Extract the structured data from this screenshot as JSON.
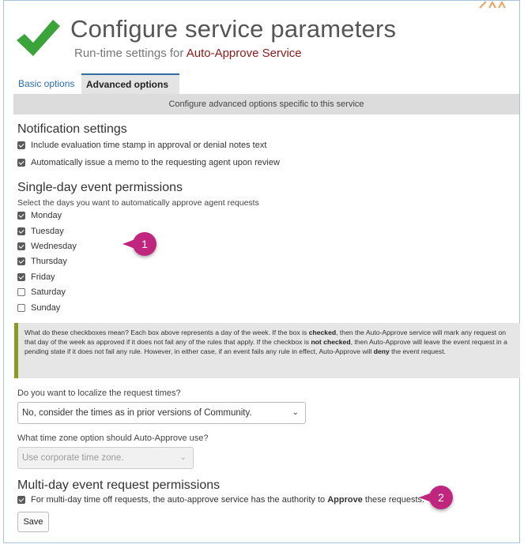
{
  "header": {
    "title": "Configure service parameters",
    "subtitle_prefix": "Run-time settings for",
    "service_name": "Auto-Approve Service"
  },
  "tabs": [
    {
      "label": "Basic options",
      "active": false
    },
    {
      "label": "Advanced options",
      "active": true
    }
  ],
  "banner": "Configure advanced options specific to this service",
  "notification": {
    "heading": "Notification settings",
    "options": [
      {
        "label": "Include evaluation time stamp in approval or denial notes text",
        "checked": true
      },
      {
        "label": "Automatically issue a memo to the requesting agent upon review",
        "checked": true
      }
    ]
  },
  "single_day": {
    "heading": "Single-day event permissions",
    "description": "Select the days you want to automatically approve agent requests",
    "days": [
      {
        "label": "Monday",
        "checked": true
      },
      {
        "label": "Tuesday",
        "checked": true
      },
      {
        "label": "Wednesday",
        "checked": true
      },
      {
        "label": "Thursday",
        "checked": true
      },
      {
        "label": "Friday",
        "checked": true
      },
      {
        "label": "Saturday",
        "checked": false
      },
      {
        "label": "Sunday",
        "checked": false
      }
    ]
  },
  "info": {
    "p1": "What do these checkboxes mean? Each box above represents a day of the week. If the box is ",
    "b1": "checked",
    "p2": ", then the Auto-Approve service will mark any request on that day of the week as approved if it does not fail any of the rules that apply. If the checkbox is ",
    "b2": "not checked",
    "p3": ", then Auto-Approve will leave the event request in a pending state if it does not fail any rule. However, in either case, if an event fails any rule in effect, Auto-Approve will ",
    "b3": "deny",
    "p4": " the event request."
  },
  "localize": {
    "question": "Do you want to localize the request times?",
    "selected": "No, consider the times as in prior versions of Community."
  },
  "timezone": {
    "question": "What time zone option should Auto-Approve use?",
    "selected": "Use corporate time zone."
  },
  "multi_day": {
    "heading": "Multi-day event request permissions",
    "option_prefix": "For multi-day time off requests, the auto-approve service has the authority to ",
    "option_bold": "Approve",
    "option_suffix": " these requests.",
    "checked": true
  },
  "save_label": "Save",
  "callouts": [
    "1",
    "2"
  ],
  "colors": {
    "check_green": "#3aa33a",
    "service_red": "#8b1a1a",
    "tab_link": "#2a6db0",
    "callout_magenta": "#c0267e",
    "info_border": "#8a9a23"
  },
  "icons": {
    "header": "checkmark-icon",
    "select": "chevron-down-icon"
  }
}
